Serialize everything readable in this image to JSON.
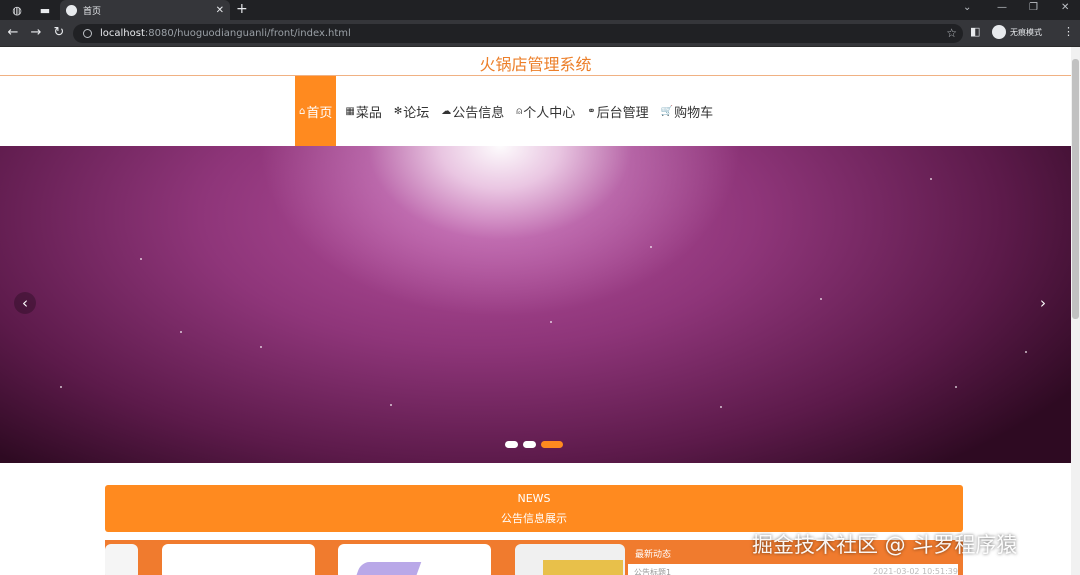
{
  "browser": {
    "tab_title": "首页",
    "url_host": "localhost",
    "url_path": ":8080/huoguodianguanli/front/index.html",
    "incognito_label": "无痕模式"
  },
  "site": {
    "title": "火锅店管理系统",
    "accent_color": "#ff8a1f"
  },
  "nav": [
    {
      "icon": "home-icon",
      "glyph": "⌂",
      "label": "首页",
      "active": true
    },
    {
      "icon": "dish-icon",
      "glyph": "▦",
      "label": "菜品"
    },
    {
      "icon": "forum-icon",
      "glyph": "✻",
      "label": "论坛"
    },
    {
      "icon": "notice-icon",
      "glyph": "☁",
      "label": "公告信息"
    },
    {
      "icon": "user-icon",
      "glyph": "⍝",
      "label": "个人中心"
    },
    {
      "icon": "link-icon",
      "glyph": "⚭",
      "label": "后台管理"
    },
    {
      "icon": "cart-icon",
      "glyph": "🛒",
      "label": "购物车"
    }
  ],
  "carousel": {
    "slides_count": 3,
    "active_index": 2
  },
  "news": {
    "heading_en": "NEWS",
    "heading_cn": "公告信息展示",
    "latest_title": "最新动态",
    "latest_row_text": "公告标题1",
    "latest_row_date": "2021-03-02 10:51:39"
  },
  "watermark": "掘金技术社区 @ 斗罗程序猿"
}
